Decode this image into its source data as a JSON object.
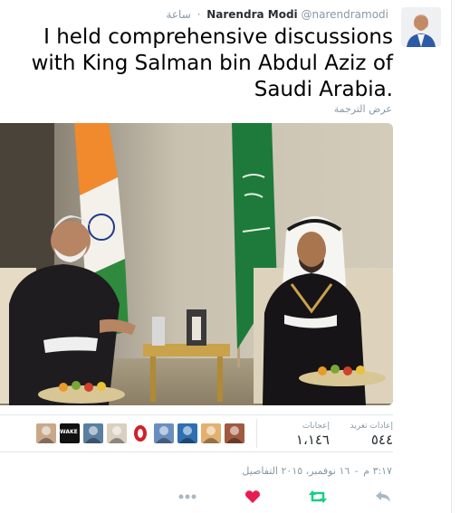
{
  "tweet": {
    "author_name": "Narendra Modi",
    "author_handle": "@narendramodi",
    "timestamp": "ساعة",
    "separator": "·",
    "text": "I held comprehensive discussions with King Salman bin Abdul Aziz of Saudi Arabia.",
    "translate_label": "عرض الترجمة"
  },
  "stats": {
    "retweets_label": "إعادات تغريد",
    "retweets_value": "٥٤٤",
    "favorites_label": "إعجابات",
    "favorites_value": "١،١٤٦",
    "liker_avatars": [
      {
        "icon": "person-avatar-icon",
        "color": "#c9a88a"
      },
      {
        "icon": "wake-up-avatar-icon",
        "color": "#111111",
        "text": "WAKE UP"
      },
      {
        "icon": "person-avatar-icon",
        "color": "#5b7f9e"
      },
      {
        "icon": "person-avatar-icon",
        "color": "#d9d0c0"
      },
      {
        "icon": "circle-avatar-icon",
        "color": "#d0202a"
      },
      {
        "icon": "person-avatar-icon",
        "color": "#6a8fbf"
      },
      {
        "icon": "person-avatar-icon",
        "color": "#2f6fb0"
      },
      {
        "icon": "person-avatar-icon",
        "color": "#e3b070"
      },
      {
        "icon": "person-avatar-icon",
        "color": "#a05a40"
      }
    ]
  },
  "meta": {
    "time": "٣:١٧ م",
    "separator": "-",
    "date": "١٦ نوفمبر، ٢٠١٥",
    "details_label": "التفاصيل"
  },
  "colors": {
    "retweet_active": "#19cf86",
    "like_active": "#e81c4f",
    "icon_gray": "#aab8c2",
    "secondary_text": "#8899a6"
  }
}
